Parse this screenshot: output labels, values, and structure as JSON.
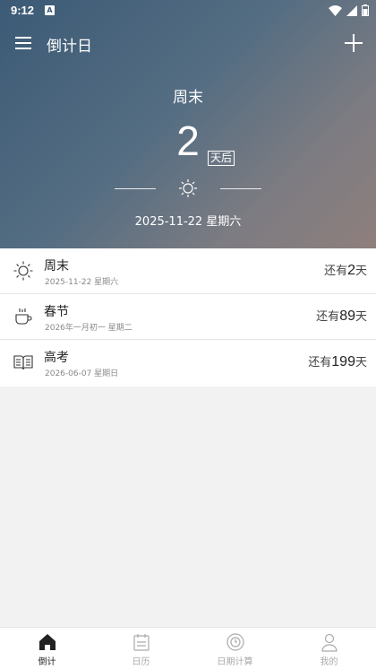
{
  "status_bar": {
    "time": "9:12",
    "badge": "A",
    "icons": [
      "wifi-icon",
      "signal-icon",
      "battery-icon"
    ]
  },
  "app_bar": {
    "title": "倒计日",
    "menu_icon": "hamburger-icon",
    "add_icon": "plus-icon"
  },
  "featured": {
    "name": "周末",
    "count": "2",
    "unit": "天后",
    "icon": "sun-icon",
    "date": "2025-11-22  星期六"
  },
  "events": [
    {
      "icon": "sun-icon",
      "title": "周末",
      "subtitle": "2025-11-22 星期六",
      "prefix": "还有",
      "count": "2",
      "unit": "天"
    },
    {
      "icon": "coffee-cup-icon",
      "title": "春节",
      "subtitle": "2026年一月初一 星期二",
      "prefix": "还有",
      "count": "89",
      "unit": "天"
    },
    {
      "icon": "book-icon",
      "title": "高考",
      "subtitle": "2026-06-07 星期日",
      "prefix": "还有",
      "count": "199",
      "unit": "天"
    }
  ],
  "nav": [
    {
      "label": "倒计",
      "icon": "home-icon",
      "active": true
    },
    {
      "label": "日历",
      "icon": "calendar-icon",
      "active": false
    },
    {
      "label": "日期计算",
      "icon": "date-calc-icon",
      "active": false
    },
    {
      "label": "我的",
      "icon": "profile-icon",
      "active": false
    }
  ],
  "colors": {
    "hero_start": "#3c5a76",
    "hero_end": "#8e7f7c",
    "nav_active": "#222222",
    "nav_inactive": "#aaaaaa"
  }
}
